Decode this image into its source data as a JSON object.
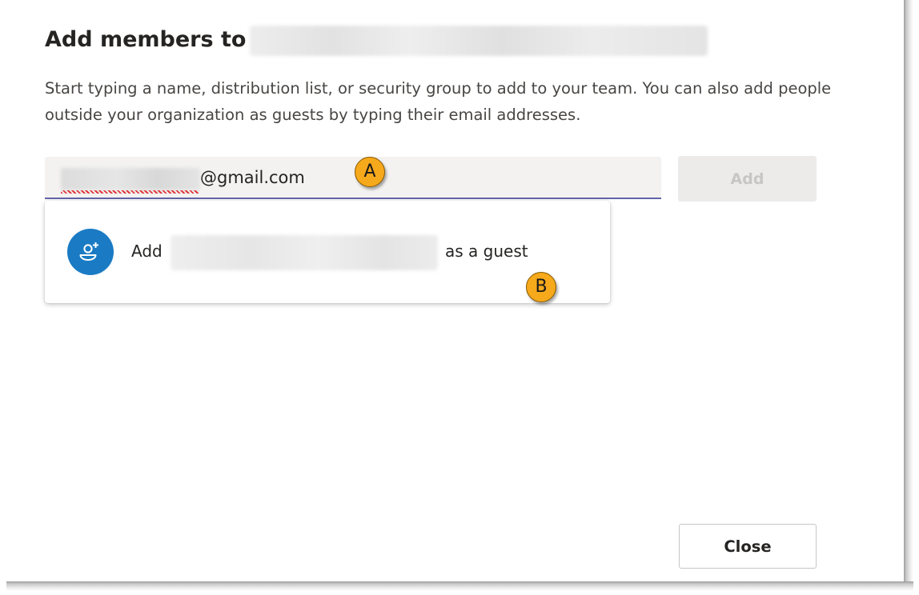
{
  "dialog": {
    "title": "Add members to",
    "description": "Start typing a name, distribution list, or security group to add to your team. You can also add people outside your organization as guests by typing their email addresses.",
    "input": {
      "value_suffix": "@gmail.com"
    },
    "add_button_label": "Add",
    "close_button_label": "Close"
  },
  "suggestion": {
    "prefix": "Add",
    "suffix": "as a guest",
    "icon": "add-guest-icon"
  },
  "callouts": {
    "a": "A",
    "b": "B"
  },
  "colors": {
    "accent": "#6264a7",
    "avatar": "#1a7bc4",
    "callout": "#f6a91b"
  }
}
